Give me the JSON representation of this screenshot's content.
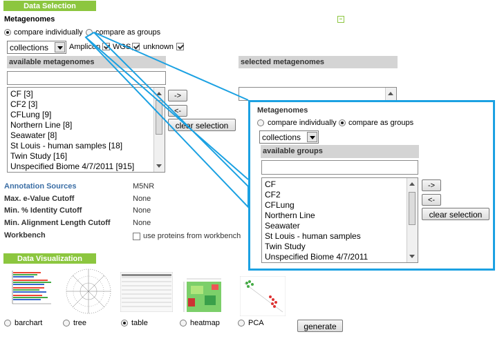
{
  "data_selection": {
    "header": "Data Selection",
    "metagenomes_label": "Metagenomes",
    "radio_individually": "compare individually",
    "radio_groups": "compare as groups",
    "collections_select": "collections",
    "filter_amplicon": "Amplicon",
    "filter_wgs": "WGS",
    "filter_unknown": "unknown",
    "available_header": "available metagenomes",
    "selected_header": "selected metagenomes",
    "available_items": [
      "CF [3]",
      "CF2 [3]",
      "CFLung [9]",
      "Northern Line [8]",
      "Seawater [8]",
      "St Louis - human samples [18]",
      "Twin Study [16]",
      "Unspecified Biome 4/7/2011 [915]"
    ],
    "add_button": "->",
    "remove_button": "<-",
    "clear_button": "clear selection"
  },
  "options": {
    "annotation_sources_label": "Annotation Sources",
    "annotation_sources_value": "M5NR",
    "evalue_label": "Max. e-Value Cutoff",
    "evalue_value": "None",
    "identity_label": "Min. % Identity Cutoff",
    "identity_value": "None",
    "alignment_label": "Min. Alignment Length Cutoff",
    "alignment_value": "None",
    "workbench_label": "Workbench",
    "workbench_checkbox": "use proteins from workbench"
  },
  "visualization": {
    "header": "Data Visualization",
    "types": [
      "barchart",
      "tree",
      "table",
      "heatmap",
      "PCA"
    ],
    "selected": "table",
    "generate_button": "generate"
  },
  "callout": {
    "metagenomes_label": "Metagenomes",
    "radio_individually": "compare individually",
    "radio_groups": "compare as groups",
    "collections_select": "collections",
    "available_header": "available groups",
    "available_items": [
      "CF",
      "CF2",
      "CFLung",
      "Northern Line",
      "Seawater",
      "St Louis - human samples",
      "Twin Study",
      "Unspecified Biome 4/7/2011"
    ],
    "add_button": "->",
    "remove_button": "<-",
    "clear_button": "clear selection"
  },
  "colors": {
    "green_header": "#8cc63f",
    "callout_border": "#1ba1e2",
    "blue_label": "#3b6ea5"
  }
}
